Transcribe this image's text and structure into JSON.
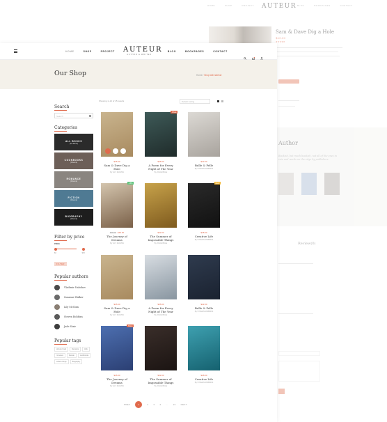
{
  "background_page": {
    "nav": [
      "HOME",
      "SHOP",
      "PROJECT",
      "BLOG",
      "BOOKPAGES",
      "CONTACT"
    ],
    "logo": "AUTEUR",
    "product_title": "Sam & Dave Dig a Hole",
    "author_heading": "Author",
    "quote": "Bookish, but much bookish, not all of the ones in rain and words on the edge by publishers.",
    "reviews_tab": "Review(0)"
  },
  "header": {
    "nav": [
      {
        "label": "HOME"
      },
      {
        "label": "SHOP"
      },
      {
        "label": "PROJECT"
      },
      {
        "label": "BLOG"
      },
      {
        "label": "BOOKPAGES"
      },
      {
        "label": "CONTACT"
      }
    ],
    "logo": "AUTEUR",
    "logo_sub": "AUTHOR & WRITER"
  },
  "banner": {
    "title": "Our Shop",
    "breadcrumb_home": "Home",
    "breadcrumb_sep": " / ",
    "breadcrumb_current": "Shop with sidebar"
  },
  "sidebar": {
    "search_title": "Search",
    "search_placeholder": "Search",
    "categories_title": "Categories",
    "categories": [
      {
        "name": "ALL BOOKS",
        "count": "(12 items)",
        "bg": "#2b2b2b"
      },
      {
        "name": "COOKBOOKS",
        "count": "(3 items)",
        "bg": "#6d5f58"
      },
      {
        "name": "ROMANCE",
        "count": "(4 items)",
        "bg": "#8a8580"
      },
      {
        "name": "FICTION",
        "count": "(3 items)",
        "bg": "#4f7a93"
      },
      {
        "name": "BIOGRAPHY",
        "count": "(2 items)",
        "bg": "#1e1e1e"
      }
    ],
    "filter_title": "Filter by price",
    "price_label": "PRICE",
    "price_min": "$0",
    "price_max": "$60",
    "filter_button": "FILTER",
    "authors_title": "Popular authors",
    "authors": [
      "Vladimir Nabokov",
      "Suzanne Walker",
      "Lily McGinn",
      "Steven Robbins",
      "Jade Stair"
    ],
    "tags_title": "Popular tags",
    "tags": [
      "picture book",
      "literature",
      "kids",
      "romance",
      "literate",
      "cookbooks",
      "writers blogs",
      "Biography"
    ]
  },
  "toolbar": {
    "result_count": "Showing 1–12 of 15 results",
    "sort_label": "Default sorting"
  },
  "products": [
    {
      "title": "Sam & Dave Dig a Hole",
      "author": "By LILY McGINN",
      "price": "$25.00",
      "old_price": "",
      "badge": "",
      "cover": [
        "#c9b48e",
        "#a88a5f"
      ]
    },
    {
      "title": "A Poem for Every Night of The Year",
      "author": "By JOLIE BULE",
      "price": "$35.00",
      "old_price": "",
      "badge": "SALE",
      "cover": [
        "#3e5a58",
        "#1f2b2a"
      ]
    },
    {
      "title": "Bulle & Pelle",
      "author": "By STEVEN ROBBINS",
      "price": "$22.00",
      "old_price": "",
      "badge": "",
      "cover": [
        "#dcd9d4",
        "#a8a39d"
      ]
    },
    {
      "title": "The Journey of Dreams",
      "author": "By LILY McGINN",
      "price": "$35.00",
      "old_price": "$45.00",
      "badge": "-15%",
      "cover": [
        "#d4c5ae",
        "#7a6048"
      ]
    },
    {
      "title": "The Summer of Impossible Things",
      "author": "By JOLIE BULE",
      "price": "$32.00",
      "old_price": "",
      "badge": "",
      "cover": [
        "#c7a24a",
        "#7e5a1e"
      ]
    },
    {
      "title": "Creative Life",
      "author": "By STEVEN ROBBINS",
      "price": "$28.00",
      "old_price": "",
      "badge": "NEW",
      "cover": [
        "#2a2a2a",
        "#111111"
      ]
    },
    {
      "title": "Sam & Dave Dig a Hole",
      "author": "By LILY McGINN",
      "price": "$25.00",
      "old_price": "",
      "badge": "",
      "cover": [
        "#c9b48e",
        "#a88a5f"
      ]
    },
    {
      "title": "A Poem for Every Night of The Year",
      "author": "By JOLIE BULE",
      "price": "$35.00",
      "old_price": "",
      "badge": "",
      "cover": [
        "#d8dde2",
        "#8895a0"
      ]
    },
    {
      "title": "Bulle & Pelle",
      "author": "By STEVEN ROBBINS",
      "price": "$22.00",
      "old_price": "",
      "badge": "",
      "cover": [
        "#2f3b4e",
        "#1a2230"
      ]
    },
    {
      "title": "The Journey of Dreams",
      "author": "By LILY McGINN",
      "price": "$25.00",
      "old_price": "",
      "badge": "SALE",
      "cover": [
        "#4d6fb0",
        "#2b3f73"
      ]
    },
    {
      "title": "The Summer of Impossible Things",
      "author": "By JOLIE BULE",
      "price": "$32.00",
      "old_price": "",
      "badge": "",
      "cover": [
        "#3a2e2a",
        "#1b1412"
      ]
    },
    {
      "title": "Creative Life",
      "author": "By STEVEN ROBBINS",
      "price": "$28.00",
      "old_price": "",
      "badge": "",
      "cover": [
        "#3ea0b0",
        "#15616f"
      ]
    }
  ],
  "pagination": [
    "PREV",
    "1",
    "2",
    "3",
    "4",
    "...",
    "24",
    "NEXT"
  ],
  "colors": {
    "accent": "#e06a4c",
    "banner_bg": "#f4f1ea",
    "sale_badge": "#e06a4c",
    "new_badge": "#f2b633",
    "discount_badge": "#5bc37a"
  }
}
